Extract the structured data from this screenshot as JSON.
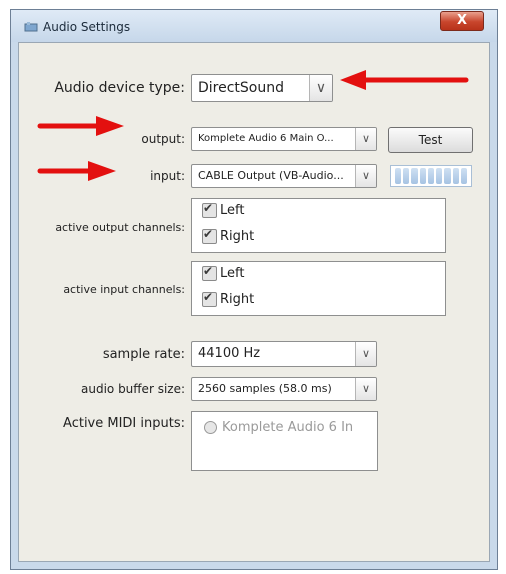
{
  "window": {
    "title": "Audio Settings",
    "close_glyph": "X"
  },
  "device_type": {
    "label": "Audio device type:",
    "value": "DirectSound"
  },
  "output": {
    "label": "output:",
    "value": "Komplete Audio 6 Main O...",
    "test_button": "Test"
  },
  "input": {
    "label": "input:",
    "value": "CABLE Output (VB-Audio..."
  },
  "active_output_channels": {
    "label": "active output channels:",
    "channels": [
      "Left",
      "Right"
    ]
  },
  "active_input_channels": {
    "label": "active input channels:",
    "channels": [
      "Left",
      "Right"
    ]
  },
  "sample_rate": {
    "label": "sample rate:",
    "value": "44100 Hz"
  },
  "buffer_size": {
    "label": "audio buffer size:",
    "value": "2560 samples (58.0 ms)"
  },
  "midi": {
    "label": "Active MIDI inputs:",
    "items": [
      "Komplete Audio 6 In"
    ]
  },
  "icons": {
    "dropdown": "chevron-down-icon",
    "annotation": "red-arrow"
  },
  "colors": {
    "annotation_red": "#e3100f",
    "meter_blue": "#a6c3e3"
  }
}
